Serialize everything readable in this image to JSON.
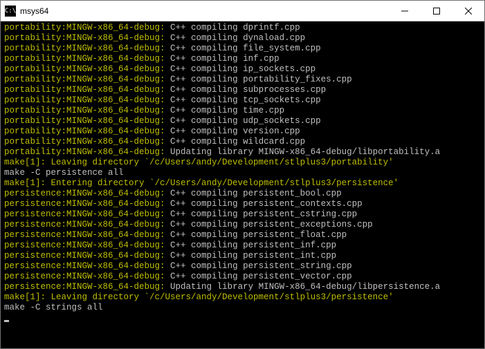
{
  "window": {
    "title": "msys64",
    "icon_text": "C:\\"
  },
  "colors": {
    "yellow": "#bfbf00",
    "text": "#c0c0c0",
    "bg": "#000000"
  },
  "terminal": {
    "lines": [
      {
        "prefix": "portability:MINGW-x86_64-debug:",
        "text": " C++ compiling dprintf.cpp"
      },
      {
        "prefix": "portability:MINGW-x86_64-debug:",
        "text": " C++ compiling dynaload.cpp"
      },
      {
        "prefix": "portability:MINGW-x86_64-debug:",
        "text": " C++ compiling file_system.cpp"
      },
      {
        "prefix": "portability:MINGW-x86_64-debug:",
        "text": " C++ compiling inf.cpp"
      },
      {
        "prefix": "portability:MINGW-x86_64-debug:",
        "text": " C++ compiling ip_sockets.cpp"
      },
      {
        "prefix": "portability:MINGW-x86_64-debug:",
        "text": " C++ compiling portability_fixes.cpp"
      },
      {
        "prefix": "portability:MINGW-x86_64-debug:",
        "text": " C++ compiling subprocesses.cpp"
      },
      {
        "prefix": "portability:MINGW-x86_64-debug:",
        "text": " C++ compiling tcp_sockets.cpp"
      },
      {
        "prefix": "portability:MINGW-x86_64-debug:",
        "text": " C++ compiling time.cpp"
      },
      {
        "prefix": "portability:MINGW-x86_64-debug:",
        "text": " C++ compiling udp_sockets.cpp"
      },
      {
        "prefix": "portability:MINGW-x86_64-debug:",
        "text": " C++ compiling version.cpp"
      },
      {
        "prefix": "portability:MINGW-x86_64-debug:",
        "text": " C++ compiling wildcard.cpp"
      },
      {
        "prefix": "portability:MINGW-x86_64-debug:",
        "text": " Updating library MINGW-x86_64-debug/libportability.a"
      },
      {
        "prefix": "",
        "yellow_text": "make[1]: Leaving directory `/c/Users/andy/Development/stlplus3/portability'"
      },
      {
        "prefix": "",
        "text": "make -C persistence all"
      },
      {
        "prefix": "",
        "yellow_text": "make[1]: Entering directory `/c/Users/andy/Development/stlplus3/persistence'"
      },
      {
        "prefix": "persistence:MINGW-x86_64-debug:",
        "text": " C++ compiling persistent_bool.cpp"
      },
      {
        "prefix": "persistence:MINGW-x86_64-debug:",
        "text": " C++ compiling persistent_contexts.cpp"
      },
      {
        "prefix": "persistence:MINGW-x86_64-debug:",
        "text": " C++ compiling persistent_cstring.cpp"
      },
      {
        "prefix": "persistence:MINGW-x86_64-debug:",
        "text": " C++ compiling persistent_exceptions.cpp"
      },
      {
        "prefix": "persistence:MINGW-x86_64-debug:",
        "text": " C++ compiling persistent_float.cpp"
      },
      {
        "prefix": "persistence:MINGW-x86_64-debug:",
        "text": " C++ compiling persistent_inf.cpp"
      },
      {
        "prefix": "persistence:MINGW-x86_64-debug:",
        "text": " C++ compiling persistent_int.cpp"
      },
      {
        "prefix": "persistence:MINGW-x86_64-debug:",
        "text": " C++ compiling persistent_string.cpp"
      },
      {
        "prefix": "persistence:MINGW-x86_64-debug:",
        "text": " C++ compiling persistent_vector.cpp"
      },
      {
        "prefix": "persistence:MINGW-x86_64-debug:",
        "text": " Updating library MINGW-x86_64-debug/libpersistence.a"
      },
      {
        "prefix": "",
        "yellow_text": "make[1]: Leaving directory `/c/Users/andy/Development/stlplus3/persistence'"
      },
      {
        "prefix": "",
        "text": "make -C strings all"
      }
    ]
  }
}
